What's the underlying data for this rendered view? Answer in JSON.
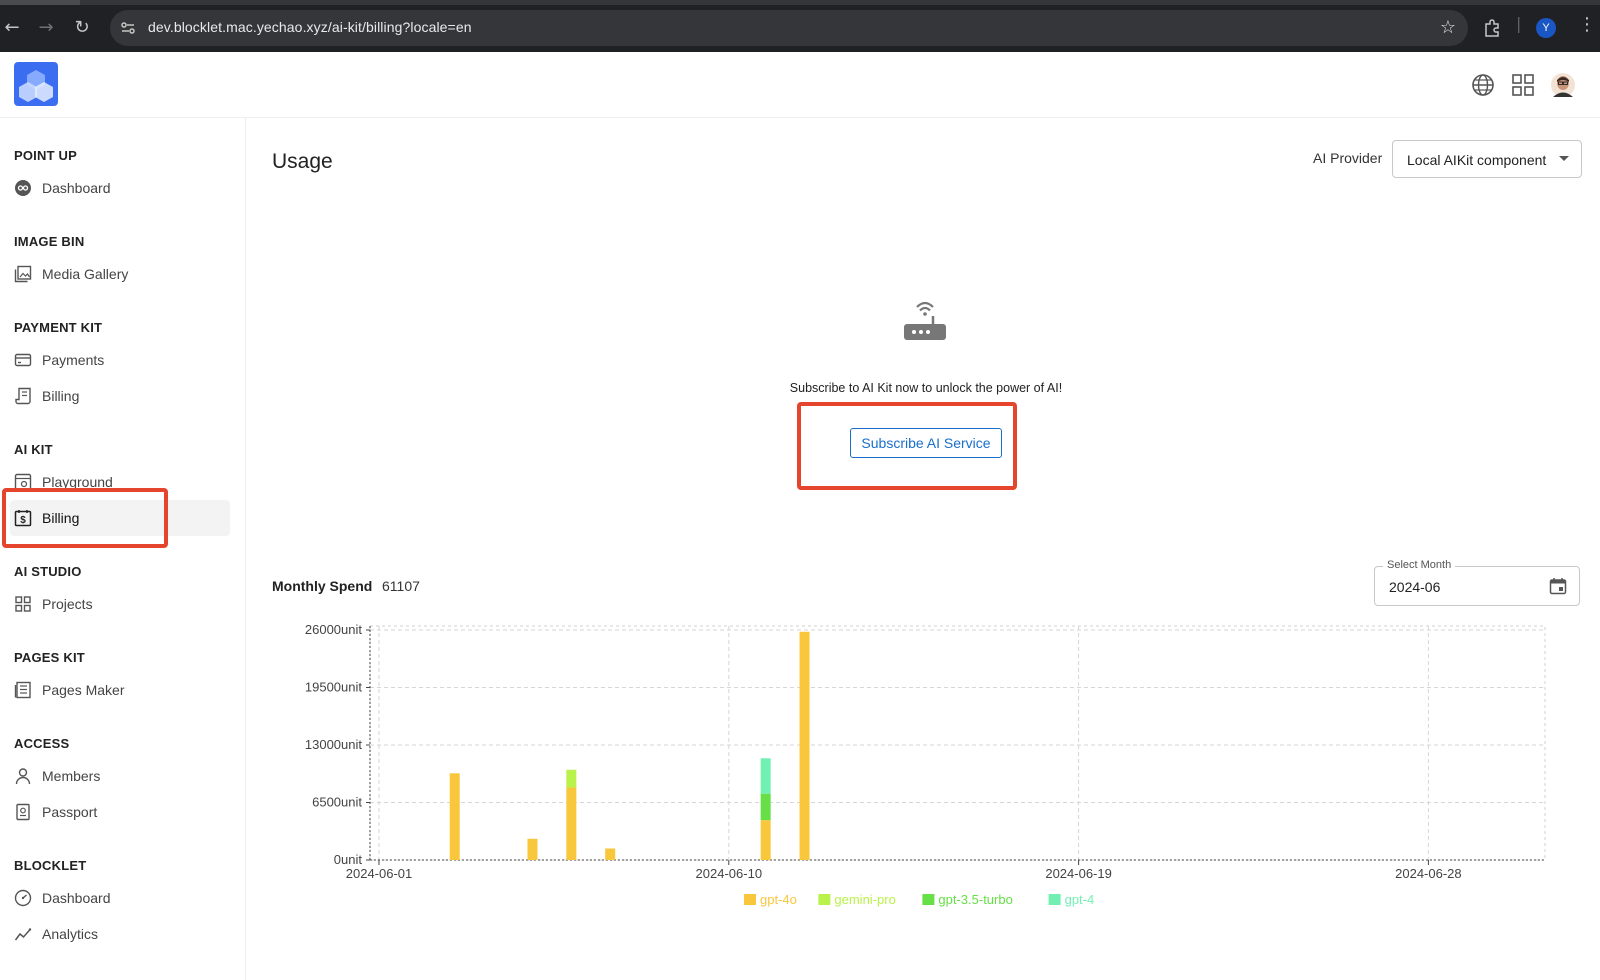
{
  "browser": {
    "url": "dev.blocklet.mac.yechao.xyz/ai-kit/billing?locale=en",
    "profile_initial": "Y"
  },
  "sidebar": {
    "groups": [
      {
        "title": "POINT UP",
        "items": [
          {
            "label": "Dashboard",
            "icon": "dashboard-icon"
          }
        ]
      },
      {
        "title": "IMAGE BIN",
        "items": [
          {
            "label": "Media Gallery",
            "icon": "gallery-icon"
          }
        ]
      },
      {
        "title": "PAYMENT KIT",
        "items": [
          {
            "label": "Payments",
            "icon": "card-icon"
          },
          {
            "label": "Billing",
            "icon": "receipt-icon"
          }
        ]
      },
      {
        "title": "AI KIT",
        "items": [
          {
            "label": "Playground",
            "icon": "playground-icon"
          },
          {
            "label": "Billing",
            "icon": "billing-icon",
            "active": true
          }
        ]
      },
      {
        "title": "AI STUDIO",
        "items": [
          {
            "label": "Projects",
            "icon": "grid-icon"
          }
        ]
      },
      {
        "title": "PAGES KIT",
        "items": [
          {
            "label": "Pages Maker",
            "icon": "pages-icon"
          }
        ]
      },
      {
        "title": "ACCESS",
        "items": [
          {
            "label": "Members",
            "icon": "person-icon"
          },
          {
            "label": "Passport",
            "icon": "passport-icon"
          }
        ]
      },
      {
        "title": "BLOCKLET",
        "items": [
          {
            "label": "Dashboard",
            "icon": "gauge-icon"
          },
          {
            "label": "Analytics",
            "icon": "analytics-icon"
          }
        ]
      }
    ]
  },
  "main": {
    "title": "Usage",
    "provider_label": "AI Provider",
    "provider_value": "Local AIKit component",
    "subscribe_message": "Subscribe to AI Kit now to unlock the power of AI!",
    "subscribe_button": "Subscribe AI Service",
    "spend_label": "Monthly Spend",
    "spend_value": "61107",
    "month_label": "Select Month",
    "month_value": "2024-06"
  },
  "colors": {
    "highlight": "#e5452d",
    "gpt-4o": "#f8c73c",
    "gemini-pro": "#b9f24a",
    "gpt-3.5-turbo": "#66e046",
    "gpt-4": "#72f0b4"
  },
  "chart_data": {
    "type": "bar",
    "stacked": true,
    "x_type": "date",
    "x": [
      "2024-06-03",
      "2024-06-05",
      "2024-06-06",
      "2024-06-07",
      "2024-06-11",
      "2024-06-12"
    ],
    "series": [
      {
        "name": "gpt-4o",
        "values": [
          9800,
          2400,
          8200,
          1300,
          4500,
          25800
        ]
      },
      {
        "name": "gemini-pro",
        "values": [
          0,
          0,
          2000,
          0,
          0,
          0
        ]
      },
      {
        "name": "gpt-3.5-turbo",
        "values": [
          0,
          0,
          0,
          0,
          3000,
          0
        ]
      },
      {
        "name": "gpt-4",
        "values": [
          0,
          0,
          0,
          0,
          4000,
          0
        ]
      }
    ],
    "ylim": [
      0,
      26000
    ],
    "y_ticks": [
      "0unit",
      "6500unit",
      "13000unit",
      "19500unit",
      "26000unit"
    ],
    "x_ticks": [
      "2024-06-01",
      "2024-06-10",
      "2024-06-19",
      "2024-06-28"
    ],
    "xlim": [
      "2024-06-01",
      "2024-06-30"
    ],
    "grid": true,
    "legend_position": "bottom"
  }
}
